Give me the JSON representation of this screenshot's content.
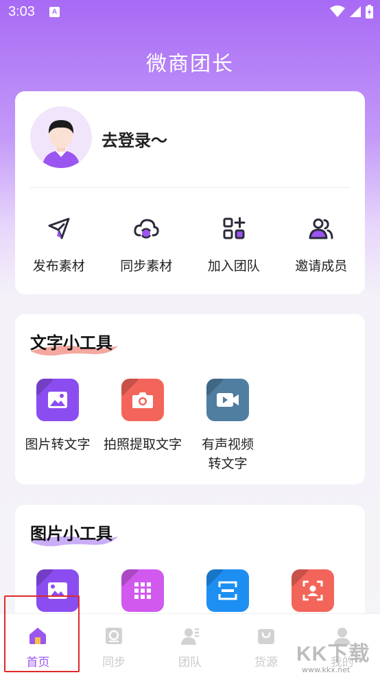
{
  "status_bar": {
    "time": "3:03",
    "badge_letter": "A"
  },
  "header": {
    "title": "微商团长"
  },
  "user_card": {
    "login_text": "去登录～",
    "actions": [
      {
        "label": "发布素材",
        "icon": "send-icon"
      },
      {
        "label": "同步素材",
        "icon": "cloud-sync-icon"
      },
      {
        "label": "加入团队",
        "icon": "grid-add-icon"
      },
      {
        "label": "邀请成员",
        "icon": "users-icon"
      }
    ]
  },
  "text_tools": {
    "title": "文字小工具",
    "items": [
      {
        "label": "图片转文字",
        "icon": "image-icon"
      },
      {
        "label": "拍照提取文字",
        "icon": "camera-icon"
      },
      {
        "label": "有声视频转文字",
        "icon": "video-icon"
      }
    ]
  },
  "image_tools": {
    "title": "图片小工具",
    "items": [
      {
        "icon": "image-edit-icon"
      },
      {
        "icon": "grid-icon"
      },
      {
        "icon": "scan-icon"
      },
      {
        "icon": "face-scan-icon"
      }
    ]
  },
  "tabbar": {
    "items": [
      {
        "label": "首页",
        "icon": "home-icon",
        "active": true
      },
      {
        "label": "同步",
        "icon": "sync-icon"
      },
      {
        "label": "团队",
        "icon": "team-icon"
      },
      {
        "label": "货源",
        "icon": "bag-icon"
      },
      {
        "label": "我的",
        "icon": "profile-icon"
      }
    ]
  },
  "watermark": {
    "brand": "KK下载",
    "url": "www.kkx.net"
  },
  "colors": {
    "accent": "#9b55f0",
    "header_gradient_top": "#a86af5",
    "tool_purple": "#8b4df0",
    "tool_coral": "#f3655a",
    "tool_slate": "#4f7ea0",
    "tool_pink": "#d159ee",
    "tool_blue": "#1e8ff2",
    "highlight": "#e0282a"
  }
}
